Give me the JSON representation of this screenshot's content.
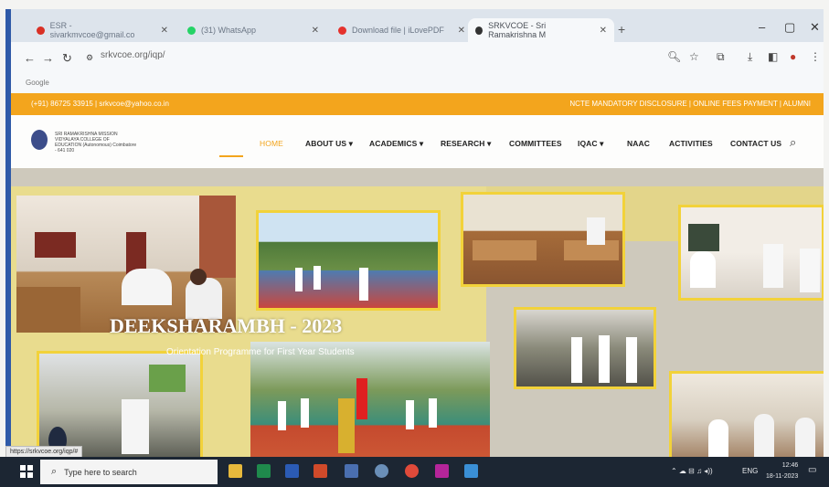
{
  "browser": {
    "tabs": [
      {
        "label": "ESR - sivarkmvcoe@gmail.co",
        "icon": "gmail-icon",
        "active": false
      },
      {
        "label": "(31) WhatsApp",
        "icon": "whatsapp-icon",
        "active": false
      },
      {
        "label": "Download file | iLovePDF",
        "icon": "ilovepdf-icon",
        "active": false
      },
      {
        "label": "SRKVCOE - Sri Ramakrishna M",
        "icon": "site-icon",
        "active": true
      }
    ],
    "new_tab": "+",
    "url": "srkvcoe.org/iqp/",
    "bookmark": "Google"
  },
  "site": {
    "contact": "(+91) 86725 33915  |  srkvcoe@yahoo.co.in",
    "top_links": "NCTE MANDATORY DISCLOSURE  |  ONLINE FEES PAYMENT  |  ALUMNI",
    "college_name": "SRI RAMAKRISHNA MISSION VIDYALAYA COLLEGE OF EDUCATION (Autonomous) Coimbatore - 641 020",
    "menu": [
      "HOME",
      "ABOUT US ▾",
      "ACADEMICS ▾",
      "RESEARCH ▾",
      "COMMITTEES",
      "IQAC ▾",
      "NAAC",
      "ACTIVITIES",
      "CONTACT US"
    ],
    "banner_title": "DEEKSHARAMBH - 2023",
    "banner_subtitle": "Orientation Programme for First Year Students"
  },
  "status_url": "https://srkvcoe.org/iqp/#",
  "taskbar": {
    "search_placeholder": "Type here to search",
    "lang": "ENG",
    "time": "12:46",
    "date": "18-11-2023"
  },
  "colors": {
    "accent": "#f3a51d",
    "photo_border": "#f2d23a",
    "taskbar": "#1c2633"
  }
}
